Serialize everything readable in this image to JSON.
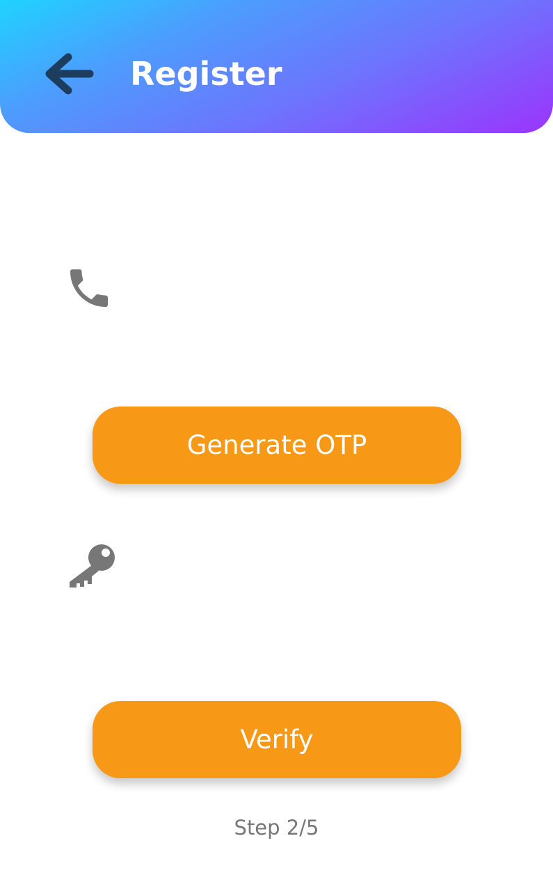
{
  "header": {
    "title": "Register",
    "back_icon": "arrow-left-icon",
    "gradient_colors": [
      "#1fd3fe",
      "#6e73fd",
      "#9b34fc"
    ]
  },
  "phone_field": {
    "icon": "phone-icon",
    "value": "",
    "placeholder": ""
  },
  "generate_otp_button": {
    "label": "Generate OTP"
  },
  "otp_field": {
    "icon": "key-icon",
    "value": "",
    "placeholder": ""
  },
  "verify_button": {
    "label": "Verify"
  },
  "progress": {
    "text": "Step 2/5",
    "current_step": 2,
    "total_steps": 5
  },
  "colors": {
    "accent": "#f79817",
    "icon_gray": "#777777",
    "back_arrow": "#1d3d5e"
  }
}
